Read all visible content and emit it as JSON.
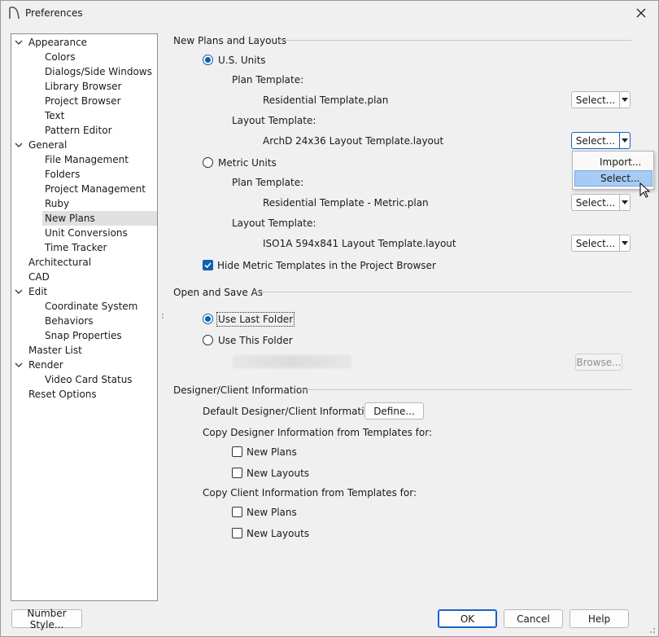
{
  "window": {
    "title": "Preferences"
  },
  "tree": {
    "items": [
      {
        "label": "Appearance",
        "level": 0,
        "expanded": true
      },
      {
        "label": "Colors",
        "level": 1
      },
      {
        "label": "Dialogs/Side Windows",
        "level": 1
      },
      {
        "label": "Library Browser",
        "level": 1
      },
      {
        "label": "Project Browser",
        "level": 1
      },
      {
        "label": "Text",
        "level": 1
      },
      {
        "label": "Pattern Editor",
        "level": 1
      },
      {
        "label": "General",
        "level": 0,
        "expanded": true
      },
      {
        "label": "File Management",
        "level": 1
      },
      {
        "label": "Folders",
        "level": 1
      },
      {
        "label": "Project Management",
        "level": 1
      },
      {
        "label": "Ruby",
        "level": 1
      },
      {
        "label": "New Plans",
        "level": 1,
        "selected": true
      },
      {
        "label": "Unit Conversions",
        "level": 1
      },
      {
        "label": "Time Tracker",
        "level": 1
      },
      {
        "label": "Architectural",
        "level": 0
      },
      {
        "label": "CAD",
        "level": 0
      },
      {
        "label": "Edit",
        "level": 0,
        "expanded": true
      },
      {
        "label": "Coordinate System",
        "level": 1
      },
      {
        "label": "Behaviors",
        "level": 1
      },
      {
        "label": "Snap Properties",
        "level": 1
      },
      {
        "label": "Master List",
        "level": 0
      },
      {
        "label": "Render",
        "level": 0,
        "expanded": true
      },
      {
        "label": "Video Card Status",
        "level": 1
      },
      {
        "label": "Reset Options",
        "level": 0
      }
    ]
  },
  "new_plans": {
    "header": "New Plans and Layouts",
    "us_units": "U.S. Units",
    "us_plan_template_label": "Plan Template:",
    "us_plan_template_value": "Residential Template.plan",
    "us_layout_template_label": "Layout Template:",
    "us_layout_template_value": "ArchD 24x36 Layout Template.layout",
    "metric_units": "Metric Units",
    "metric_plan_template_label": "Plan Template:",
    "metric_plan_template_value": "Residential Template - Metric.plan",
    "metric_layout_template_label": "Layout Template:",
    "metric_layout_template_value": "ISO1A 594x841 Layout Template.layout",
    "select_label": "Select...",
    "hide_metric_label": "Hide Metric Templates in the Project Browser",
    "selected_units": "U.S. Units",
    "hide_metric_checked": true
  },
  "dropdown_menu": {
    "items": [
      "Import...",
      "Select..."
    ],
    "hovered": "Select..."
  },
  "open_save": {
    "header": "Open and Save As",
    "use_last_folder": "Use Last Folder",
    "use_this_folder": "Use This Folder",
    "browse_label": "Browse...",
    "selected": "Use Last Folder"
  },
  "designer_client": {
    "header": "Designer/Client Information",
    "default_label": "Default Designer/Client Information:",
    "define_label": "Define...",
    "copy_designer_label": "Copy Designer Information from Templates for:",
    "designer_new_plans": "New Plans",
    "designer_new_layouts": "New Layouts",
    "copy_client_label": "Copy Client Information from Templates for:",
    "client_new_plans": "New Plans",
    "client_new_layouts": "New Layouts"
  },
  "footer": {
    "number_style": "Number Style...",
    "ok": "OK",
    "cancel": "Cancel",
    "help": "Help"
  },
  "colors": {
    "accent": "#0f5fb5",
    "menu_highlight": "#a6cbf4",
    "selected_tree_bg": "#e0e0e0"
  }
}
